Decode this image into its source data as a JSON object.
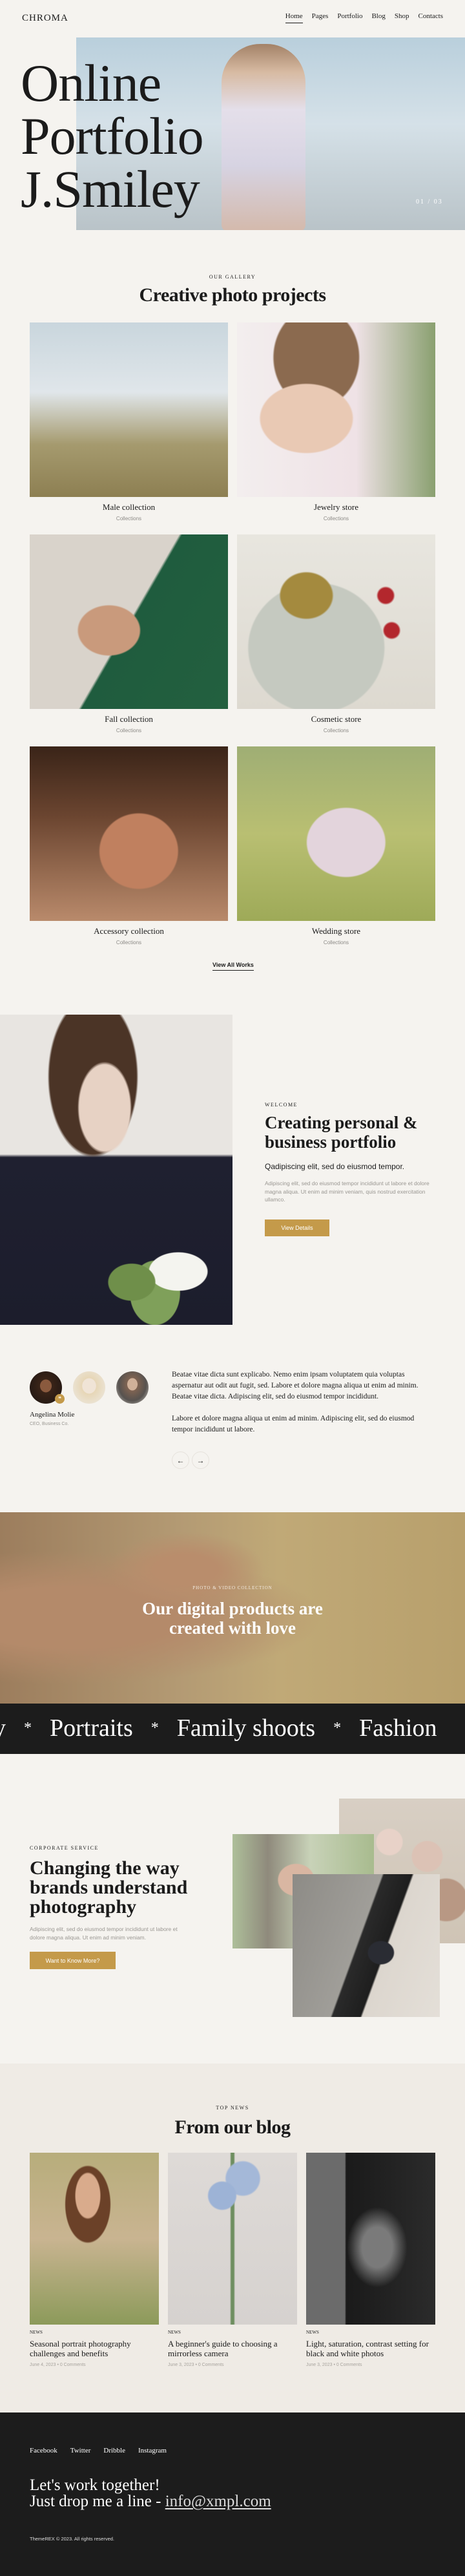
{
  "header": {
    "logo": "CHROMA",
    "nav": [
      "Home",
      "Pages",
      "Portfolio",
      "Blog",
      "Shop",
      "Contacts"
    ],
    "active_nav": "Home"
  },
  "hero": {
    "title_lines": [
      "Online",
      "Portfolio",
      "J.Smiley"
    ],
    "slide_current": "01",
    "slide_separator": "/",
    "slide_total": "03"
  },
  "gallery": {
    "eyebrow": "OUR GALLERY",
    "title": "Creative photo projects",
    "items": [
      {
        "title": "Male collection",
        "category": "Collections"
      },
      {
        "title": "Jewelry store",
        "category": "Collections"
      },
      {
        "title": "Fall collection",
        "category": "Collections"
      },
      {
        "title": "Cosmetic store",
        "category": "Collections"
      },
      {
        "title": "Accessory collection",
        "category": "Collections"
      },
      {
        "title": "Wedding store",
        "category": "Collections"
      }
    ],
    "view_all": "View All Works"
  },
  "welcome": {
    "eyebrow": "WELCOME",
    "title_lines": [
      "Creating personal &",
      "business portfolio"
    ],
    "subtitle": "Qadipiscing elit, sed do eiusmod tempor.",
    "paragraph": "Adipiscing elit, sed do eiusmod tempor incididunt ut labore et dolore magna aliqua. Ut enim ad minim veniam, quis nostrud exercitation ullamco.",
    "button": "View Details"
  },
  "testimonial": {
    "name": "Angelina Molie",
    "role": "CEO, Business Co.",
    "paragraphs": [
      "Beatae vitae dicta sunt explicabo. Nemo enim ipsam voluptatem quia voluptas aspernatur aut odit aut fugit, sed. Labore et dolore magna aliqua ut enim ad minim. Beatae vitae dicta. Adipiscing elit, sed do eiusmod tempor incididunt.",
      "Labore et dolore magna aliqua ut enim ad minim. Adipiscing elit, sed do eiusmod tempor incididunt ut labore."
    ],
    "prev": "←",
    "next": "→",
    "quote_icon": "quote-icon"
  },
  "banner": {
    "eyebrow": "PHOTO & VIDEO COLLECTION",
    "title_lines": [
      "Our digital products are",
      "created with love"
    ]
  },
  "marquee": {
    "items": [
      "y",
      "Portraits",
      "Family shoots",
      "Fashion"
    ],
    "separator": "*"
  },
  "corporate": {
    "eyebrow": "CORPORATE SERVICE",
    "title_lines": [
      "Changing the way",
      "brands understand",
      "photography"
    ],
    "paragraph": "Adipiscing elit, sed do eiusmod tempor incididunt ut labore et dolore magna aliqua. Ut enim ad minim veniam.",
    "button": "Want to Know More?"
  },
  "blog": {
    "eyebrow": "TOP NEWS",
    "title": "From our blog",
    "posts": [
      {
        "category": "NEWS",
        "title": "Seasonal portrait photography challenges and benefits",
        "date": "June 4, 2023",
        "comments": "0 Comments"
      },
      {
        "category": "NEWS",
        "title": "A beginner's guide to choosing a mirrorless camera",
        "date": "June 3, 2023",
        "comments": "0 Comments"
      },
      {
        "category": "NEWS",
        "title": "Light, saturation, contrast setting for black and white photos",
        "date": "June 3, 2023",
        "comments": "0 Comments"
      }
    ],
    "meta_separator": "•"
  },
  "footer": {
    "social": [
      "Facebook",
      "Twitter",
      "Dribble",
      "Instagram"
    ],
    "line1": "Let's work together!",
    "line2_prefix": "Just drop me a line - ",
    "email": "info@xmpl.com",
    "copyright": "ThemeREX © 2023. All rights reserved."
  },
  "colors": {
    "background": "#f5f3ef",
    "accent": "#c49a4a",
    "dark": "#1c1c1c",
    "blog_background": "#efebe5"
  }
}
